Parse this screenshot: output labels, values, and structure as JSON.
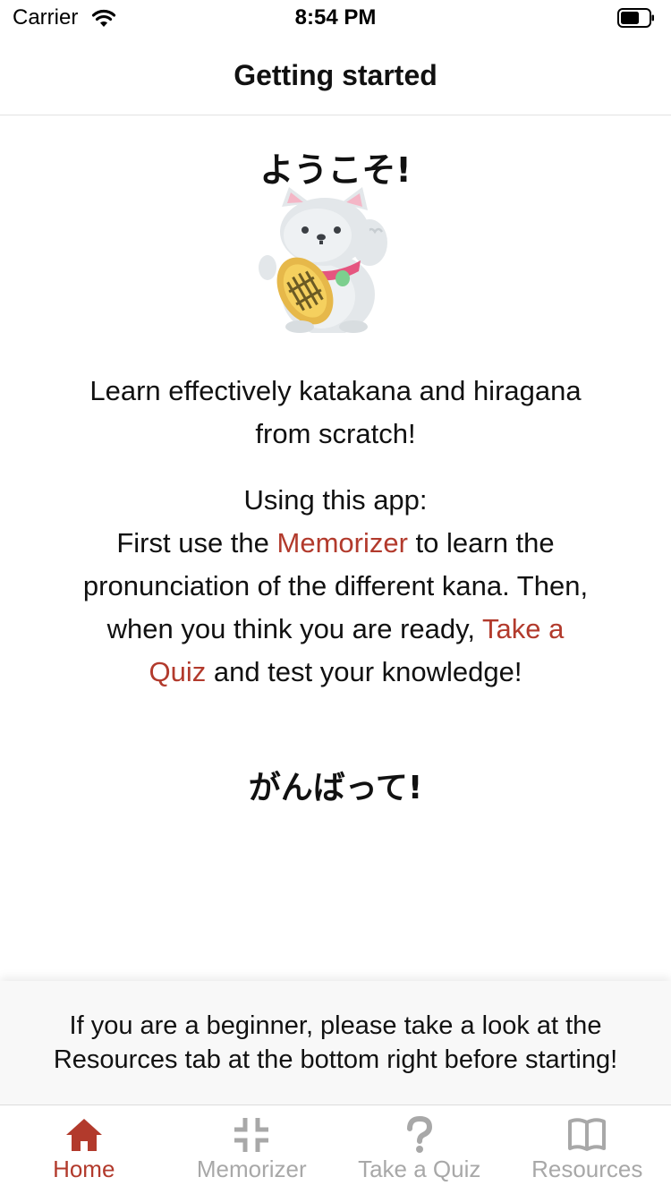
{
  "status_bar": {
    "carrier": "Carrier",
    "time": "8:54 PM"
  },
  "header": {
    "title": "Getting started"
  },
  "main": {
    "welcome": "ようこそ!",
    "illustration": "maneki-neko-cat",
    "intro": "Learn effectively katakana and hiragana from scratch!",
    "usage_heading": "Using this app:",
    "usage_1": "First use the ",
    "link_memorizer": "Memorizer",
    "usage_2": " to learn the pronunciation of the different kana. Then, when you think you are ready, ",
    "link_quiz": "Take a Quiz",
    "usage_3": " and test your knowledge!",
    "cheer": "がんばって!"
  },
  "banner": {
    "text": "If you are a beginner, please take a look at the Resources tab at the bottom right before starting!"
  },
  "tabs": [
    {
      "label": "Home",
      "icon": "home-icon",
      "active": true
    },
    {
      "label": "Memorizer",
      "icon": "compress-icon",
      "active": false
    },
    {
      "label": "Take a Quiz",
      "icon": "question-icon",
      "active": false
    },
    {
      "label": "Resources",
      "icon": "book-icon",
      "active": false
    }
  ],
  "colors": {
    "accent": "#b23a2c",
    "inactive": "#a8a8a8"
  }
}
